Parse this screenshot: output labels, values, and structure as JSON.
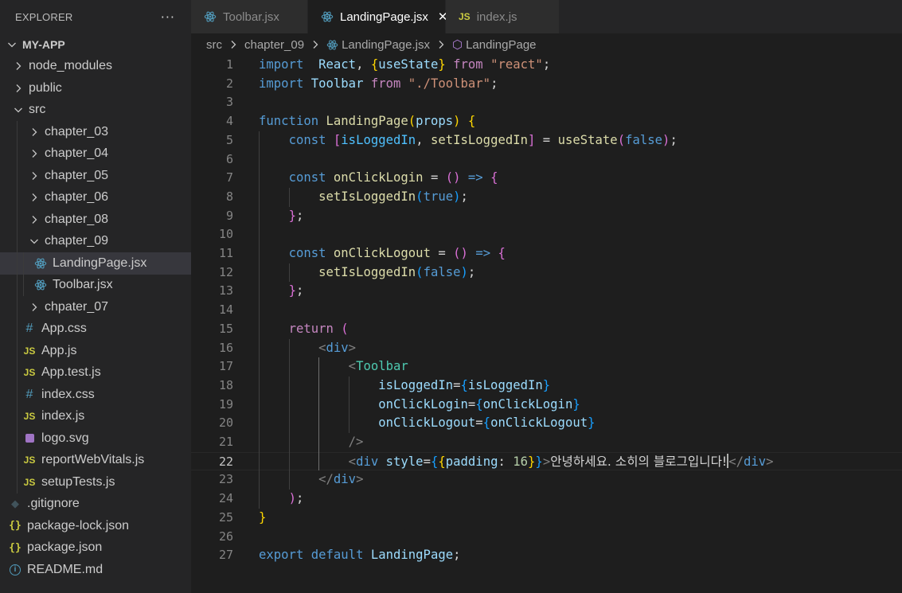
{
  "explorer": {
    "title": "EXPLORER",
    "more": "···",
    "tree": [
      {
        "label": "MY-APP",
        "depth": 0,
        "kind": "root",
        "chev": "open"
      },
      {
        "label": "node_modules",
        "depth": 1,
        "kind": "folder",
        "chev": "closed"
      },
      {
        "label": "public",
        "depth": 1,
        "kind": "folder",
        "chev": "closed"
      },
      {
        "label": "src",
        "depth": 1,
        "kind": "folder",
        "chev": "open"
      },
      {
        "label": "chapter_03",
        "depth": 2,
        "kind": "folder",
        "chev": "closed"
      },
      {
        "label": "chapter_04",
        "depth": 2,
        "kind": "folder",
        "chev": "closed"
      },
      {
        "label": "chapter_05",
        "depth": 2,
        "kind": "folder",
        "chev": "closed"
      },
      {
        "label": "chapter_06",
        "depth": 2,
        "kind": "folder",
        "chev": "closed"
      },
      {
        "label": "chapter_08",
        "depth": 2,
        "kind": "folder",
        "chev": "closed"
      },
      {
        "label": "chapter_09",
        "depth": 2,
        "kind": "folder",
        "chev": "open"
      },
      {
        "label": "LandingPage.jsx",
        "depth": 3,
        "kind": "react",
        "selected": true
      },
      {
        "label": "Toolbar.jsx",
        "depth": 3,
        "kind": "react"
      },
      {
        "label": "chpater_07",
        "depth": 2,
        "kind": "folder",
        "chev": "closed"
      },
      {
        "label": "App.css",
        "depth": 2,
        "kind": "css"
      },
      {
        "label": "App.js",
        "depth": 2,
        "kind": "js"
      },
      {
        "label": "App.test.js",
        "depth": 2,
        "kind": "js"
      },
      {
        "label": "index.css",
        "depth": 2,
        "kind": "css"
      },
      {
        "label": "index.js",
        "depth": 2,
        "kind": "js"
      },
      {
        "label": "logo.svg",
        "depth": 2,
        "kind": "svg"
      },
      {
        "label": "reportWebVitals.js",
        "depth": 2,
        "kind": "js"
      },
      {
        "label": "setupTests.js",
        "depth": 2,
        "kind": "js"
      },
      {
        "label": ".gitignore",
        "depth": 1,
        "kind": "git"
      },
      {
        "label": "package-lock.json",
        "depth": 1,
        "kind": "json"
      },
      {
        "label": "package.json",
        "depth": 1,
        "kind": "json"
      },
      {
        "label": "README.md",
        "depth": 1,
        "kind": "info"
      }
    ]
  },
  "tabs": [
    {
      "label": "Toolbar.jsx",
      "kind": "react",
      "active": false
    },
    {
      "label": "LandingPage.jsx",
      "kind": "react",
      "active": true,
      "close": "✕"
    },
    {
      "label": "index.js",
      "kind": "js",
      "active": false
    }
  ],
  "breadcrumb": [
    "src",
    "chapter_09",
    "LandingPage.jsx",
    "LandingPage"
  ],
  "editor": {
    "current_line": 22,
    "lines": [
      [
        [
          "kw",
          "import"
        ],
        [
          "",
          "  "
        ],
        [
          "vr",
          "React"
        ],
        [
          "",
          ", "
        ],
        [
          "b1",
          "{"
        ],
        [
          "vr",
          "useState"
        ],
        [
          "b1",
          "}"
        ],
        [
          "",
          " "
        ],
        [
          "ctl",
          "from"
        ],
        [
          "",
          " "
        ],
        [
          "str",
          "\"react\""
        ],
        [
          "",
          ";"
        ]
      ],
      [
        [
          "kw",
          "import"
        ],
        [
          "",
          " "
        ],
        [
          "vr",
          "Toolbar"
        ],
        [
          "",
          " "
        ],
        [
          "ctl",
          "from"
        ],
        [
          "",
          " "
        ],
        [
          "str",
          "\"./Toolbar\""
        ],
        [
          "",
          ";"
        ]
      ],
      [],
      [
        [
          "kw",
          "function"
        ],
        [
          "",
          " "
        ],
        [
          "fn",
          "LandingPage"
        ],
        [
          "b1",
          "("
        ],
        [
          "vr",
          "props"
        ],
        [
          "b1",
          ")"
        ],
        [
          "",
          " "
        ],
        [
          "b1",
          "{"
        ]
      ],
      [
        [
          "",
          "    "
        ],
        [
          "kw",
          "const"
        ],
        [
          "",
          " "
        ],
        [
          "b2",
          "["
        ],
        [
          "con",
          "isLoggedIn"
        ],
        [
          "",
          ", "
        ],
        [
          "fn",
          "setIsLoggedIn"
        ],
        [
          "b2",
          "]"
        ],
        [
          "",
          " = "
        ],
        [
          "fn",
          "useState"
        ],
        [
          "b2",
          "("
        ],
        [
          "kw",
          "false"
        ],
        [
          "b2",
          ")"
        ],
        [
          "",
          ";"
        ]
      ],
      [],
      [
        [
          "",
          "    "
        ],
        [
          "kw",
          "const"
        ],
        [
          "",
          " "
        ],
        [
          "fn",
          "onClickLogin"
        ],
        [
          "",
          " = "
        ],
        [
          "b2",
          "()"
        ],
        [
          "",
          " "
        ],
        [
          "kw",
          "=>"
        ],
        [
          "",
          " "
        ],
        [
          "b2",
          "{"
        ]
      ],
      [
        [
          "",
          "        "
        ],
        [
          "fn",
          "setIsLoggedIn"
        ],
        [
          "b3",
          "("
        ],
        [
          "kw",
          "true"
        ],
        [
          "b3",
          ")"
        ],
        [
          "",
          ";"
        ]
      ],
      [
        [
          "",
          "    "
        ],
        [
          "b2",
          "}"
        ],
        [
          "",
          ";"
        ]
      ],
      [],
      [
        [
          "",
          "    "
        ],
        [
          "kw",
          "const"
        ],
        [
          "",
          " "
        ],
        [
          "fn",
          "onClickLogout"
        ],
        [
          "",
          " = "
        ],
        [
          "b2",
          "()"
        ],
        [
          "",
          " "
        ],
        [
          "kw",
          "=>"
        ],
        [
          "",
          " "
        ],
        [
          "b2",
          "{"
        ]
      ],
      [
        [
          "",
          "        "
        ],
        [
          "fn",
          "setIsLoggedIn"
        ],
        [
          "b3",
          "("
        ],
        [
          "kw",
          "false"
        ],
        [
          "b3",
          ")"
        ],
        [
          "",
          ";"
        ]
      ],
      [
        [
          "",
          "    "
        ],
        [
          "b2",
          "}"
        ],
        [
          "",
          ";"
        ]
      ],
      [],
      [
        [
          "",
          "    "
        ],
        [
          "ctl",
          "return"
        ],
        [
          "",
          " "
        ],
        [
          "b2",
          "("
        ]
      ],
      [
        [
          "",
          "        "
        ],
        [
          "tg",
          "<"
        ],
        [
          "kw",
          "div"
        ],
        [
          "tg",
          ">"
        ]
      ],
      [
        [
          "",
          "            "
        ],
        [
          "tg",
          "<"
        ],
        [
          "cmp",
          "Toolbar"
        ]
      ],
      [
        [
          "",
          "                "
        ],
        [
          "vr",
          "isLoggedIn"
        ],
        [
          "",
          "="
        ],
        [
          "b3",
          "{"
        ],
        [
          "vr",
          "isLoggedIn"
        ],
        [
          "b3",
          "}"
        ]
      ],
      [
        [
          "",
          "                "
        ],
        [
          "vr",
          "onClickLogin"
        ],
        [
          "",
          "="
        ],
        [
          "b3",
          "{"
        ],
        [
          "vr",
          "onClickLogin"
        ],
        [
          "b3",
          "}"
        ]
      ],
      [
        [
          "",
          "                "
        ],
        [
          "vr",
          "onClickLogout"
        ],
        [
          "",
          "="
        ],
        [
          "b3",
          "{"
        ],
        [
          "vr",
          "onClickLogout"
        ],
        [
          "b3",
          "}"
        ]
      ],
      [
        [
          "",
          "            "
        ],
        [
          "tg",
          "/>"
        ]
      ],
      [
        [
          "",
          "            "
        ],
        [
          "tg",
          "<"
        ],
        [
          "kw",
          "div"
        ],
        [
          "",
          " "
        ],
        [
          "vr",
          "style"
        ],
        [
          "",
          "="
        ],
        [
          "b3",
          "{"
        ],
        [
          "b1",
          "{"
        ],
        [
          "vr",
          "padding"
        ],
        [
          "",
          ": "
        ],
        [
          "num",
          "16"
        ],
        [
          "b1",
          "}"
        ],
        [
          "b3",
          "}"
        ],
        [
          "tg",
          ">"
        ],
        [
          "txt",
          "안녕하세요. 소히의 블로그입니다!"
        ],
        [
          "cursor",
          ""
        ],
        [
          "tg",
          "</"
        ],
        [
          "kw",
          "div"
        ],
        [
          "tg",
          ">"
        ]
      ],
      [
        [
          "",
          "        "
        ],
        [
          "tg",
          "</"
        ],
        [
          "kw",
          "div"
        ],
        [
          "tg",
          ">"
        ]
      ],
      [
        [
          "",
          "    "
        ],
        [
          "b2",
          ")"
        ],
        [
          "",
          ";"
        ]
      ],
      [
        [
          "b1",
          "}"
        ]
      ],
      [],
      [
        [
          "kw",
          "export"
        ],
        [
          "",
          " "
        ],
        [
          "kw",
          "default"
        ],
        [
          "",
          " "
        ],
        [
          "vr",
          "LandingPage"
        ],
        [
          "",
          ";"
        ]
      ]
    ]
  }
}
